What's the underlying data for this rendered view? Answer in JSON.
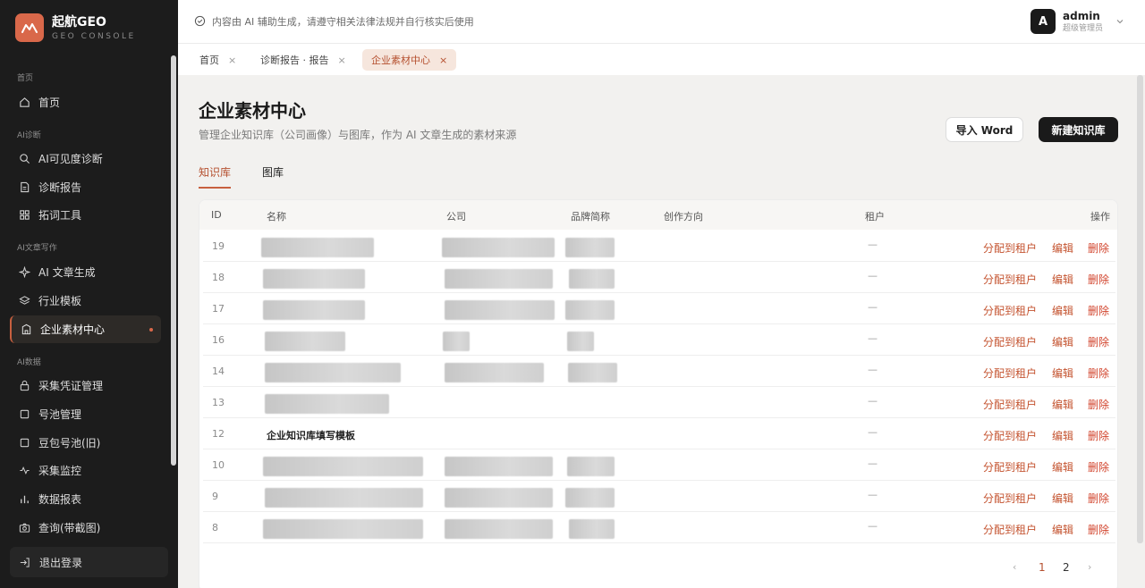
{
  "brand": {
    "title": "起航GEO",
    "subtitle": "GEO CONSOLE",
    "accent": "#d9684a"
  },
  "sidebar": {
    "sections": [
      {
        "label": "首页",
        "items": [
          {
            "label": "首页",
            "icon": "home-icon"
          }
        ]
      },
      {
        "label": "AI诊断",
        "items": [
          {
            "label": "AI可见度诊断",
            "icon": "search-icon"
          },
          {
            "label": "诊断报告",
            "icon": "document-icon"
          },
          {
            "label": "拓词工具",
            "icon": "grid-icon"
          }
        ]
      },
      {
        "label": "AI文章写作",
        "items": [
          {
            "label": "AI 文章生成",
            "icon": "sparkle-icon"
          },
          {
            "label": "行业模板",
            "icon": "layers-icon"
          },
          {
            "label": "企业素材中心",
            "icon": "building-icon",
            "active": true
          }
        ]
      },
      {
        "label": "AI数据",
        "items": [
          {
            "label": "采集凭证管理",
            "icon": "lock-icon"
          },
          {
            "label": "号池管理",
            "icon": "square-icon"
          },
          {
            "label": "豆包号池(旧)",
            "icon": "square-icon"
          },
          {
            "label": "采集监控",
            "icon": "monitor-icon"
          },
          {
            "label": "数据报表",
            "icon": "bar-chart-icon"
          },
          {
            "label": "查询(带截图)",
            "icon": "camera-icon"
          }
        ]
      }
    ],
    "logout": "退出登录"
  },
  "topbar": {
    "notice": "内容由 AI 辅助生成，请遵守相关法律法规并自行核实后使用",
    "user": {
      "avatar": "A",
      "name": "admin",
      "role": "超级管理员"
    }
  },
  "tabs": [
    {
      "label": "首页",
      "close": "×"
    },
    {
      "label": "诊断报告 · 报告",
      "close": "×"
    },
    {
      "label": "企业素材中心",
      "close": "×",
      "active": true
    }
  ],
  "page": {
    "title": "企业素材中心",
    "subtitle": "管理企业知识库（公司画像）与图库，作为 AI 文章生成的素材来源",
    "import_label": "导入 Word",
    "new_label": "新建知识库",
    "subtabs": [
      {
        "label": "知识库",
        "active": true
      },
      {
        "label": "图库"
      }
    ]
  },
  "table": {
    "columns": [
      "ID",
      "名称",
      "公司",
      "品牌简称",
      "创作方向",
      "租户",
      "操作"
    ],
    "rows": [
      {
        "id": "19",
        "name": "",
        "tenant": "—"
      },
      {
        "id": "18",
        "name": "",
        "tenant": "—"
      },
      {
        "id": "17",
        "name": "",
        "tenant": "—"
      },
      {
        "id": "16",
        "name": "",
        "tenant": "—"
      },
      {
        "id": "14",
        "name": "",
        "tenant": "—"
      },
      {
        "id": "13",
        "name": "",
        "tenant": "—"
      },
      {
        "id": "12",
        "name": "企业知识库填写模板",
        "tenant": "—"
      },
      {
        "id": "10",
        "name": "",
        "tenant": "—"
      },
      {
        "id": "9",
        "name": "",
        "tenant": "—"
      },
      {
        "id": "8",
        "name": "",
        "tenant": "—"
      }
    ],
    "actions": {
      "assign": "分配到租户",
      "edit": "编辑",
      "delete": "删除"
    }
  },
  "pagination": {
    "prev": "‹",
    "pages": [
      "1",
      "2"
    ],
    "current": "1",
    "next": "›"
  }
}
